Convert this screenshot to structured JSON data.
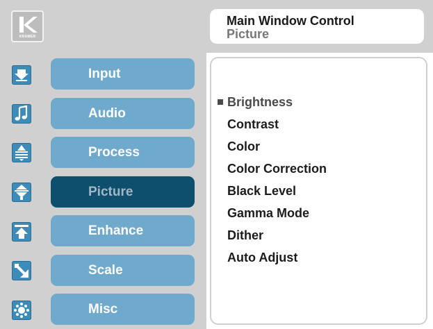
{
  "header": {
    "logo_brand": "KRAMER",
    "window_title": "Main Window Control",
    "window_subtitle": "Picture"
  },
  "sidebar": {
    "items": [
      {
        "label": "Input",
        "icon": "input-icon",
        "active": false
      },
      {
        "label": "Audio",
        "icon": "music-note-icon",
        "active": false
      },
      {
        "label": "Process",
        "icon": "process-icon",
        "active": false
      },
      {
        "label": "Picture",
        "icon": "picture-icon",
        "active": true
      },
      {
        "label": "Enhance",
        "icon": "enhance-icon",
        "active": false
      },
      {
        "label": "Scale",
        "icon": "scale-icon",
        "active": false
      },
      {
        "label": "Misc",
        "icon": "misc-icon",
        "active": false
      }
    ]
  },
  "menu": {
    "selected_index": 0,
    "items": [
      "Brightness",
      "Contrast",
      "Color",
      "Color Correction",
      "Black Level",
      "Gamma Mode",
      "Dither",
      "Auto Adjust"
    ]
  },
  "colors": {
    "header_bg": "#d0d0d0",
    "button": "#6fa9cb",
    "button_active": "#0f4f6e",
    "icon_bg": "#3d8bb8"
  }
}
